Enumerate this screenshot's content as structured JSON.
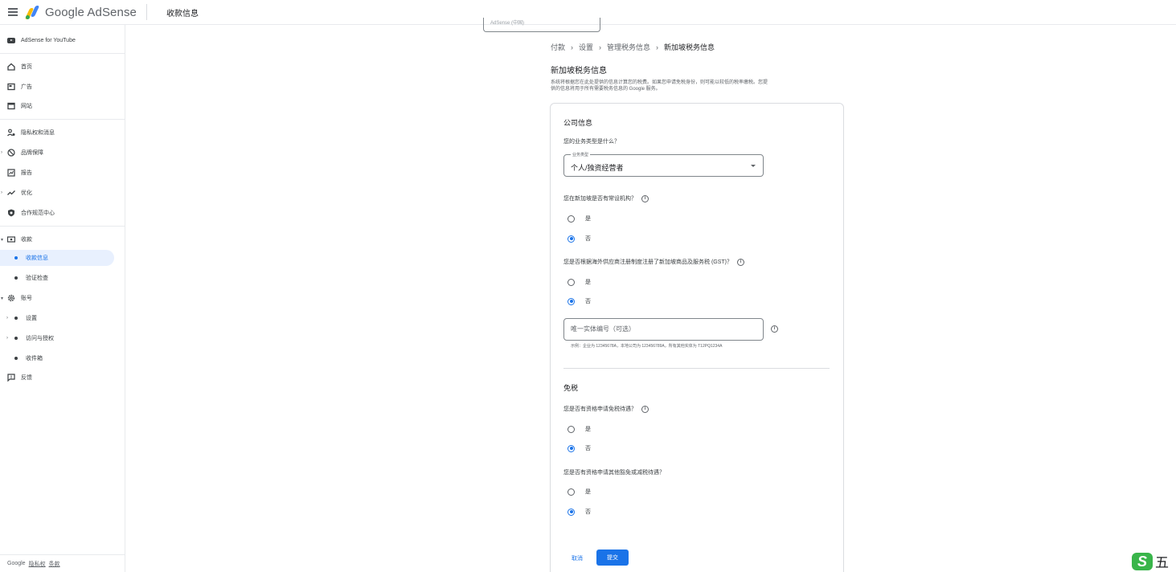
{
  "topbar": {
    "brand": "Google AdSense",
    "page_title": "收款信息"
  },
  "sidebar": {
    "items": [
      {
        "label": "AdSense for YouTube"
      },
      {
        "label": "首页"
      },
      {
        "label": "广告"
      },
      {
        "label": "网站"
      },
      {
        "label": "隐私权和消息"
      },
      {
        "label": "品牌保障"
      },
      {
        "label": "报告"
      },
      {
        "label": "优化"
      },
      {
        "label": "合作规范中心"
      },
      {
        "label": "收款"
      },
      {
        "label": "收款信息"
      },
      {
        "label": "验证检查"
      },
      {
        "label": "账号"
      },
      {
        "label": "设置"
      },
      {
        "label": "访问与授权"
      },
      {
        "label": "收件箱"
      },
      {
        "label": "反馈"
      }
    ],
    "footer": {
      "brand": "Google",
      "privacy": "隐私权",
      "terms": "条款"
    }
  },
  "main": {
    "stub_text": "AdSense (中国)",
    "breadcrumb": [
      "付款",
      "设置",
      "管理税务信息",
      "新加坡税务信息"
    ],
    "title": "新加坡税务信息",
    "description": "系统将根据您在此处提供的信息计算您的税费。如果您申请免税身份，则可能以较低的税率缴税。您提供的信息将用于所有需要税务信息的 Google 服务。",
    "company_section": {
      "title": "公司信息",
      "business_type_q": "您的业务类型是什么？",
      "select_label": "业务类型",
      "select_value": "个人/独资经营者",
      "pe_q": "您在新加坡是否有常设机构？",
      "gst_q": "您是否根据海外供应商注册制度注册了新加坡商品及服务税 (GST)？",
      "uen_placeholder": "唯一实体编号（可选）",
      "uen_hint": "示例：企业为 12345678A，本地公司为 123456789A，所有其他实体为 T12PQ1234A"
    },
    "exemption_section": {
      "title": "免税",
      "q1": "您是否有资格申请免税待遇？",
      "q2": "您是否有资格申请其他豁免或减税待遇？"
    },
    "yes": "是",
    "no": "否",
    "cancel": "取消",
    "submit": "提交"
  },
  "ime": {
    "label": "五"
  },
  "colors": {
    "accent": "#1a73e8",
    "active_bg": "#e8f0fe"
  }
}
